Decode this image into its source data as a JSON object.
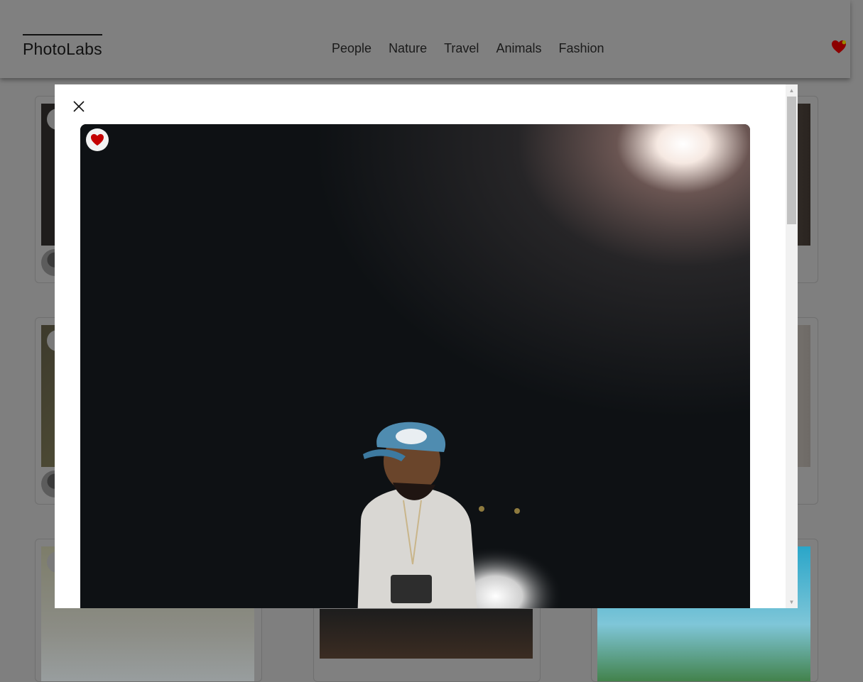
{
  "app": {
    "logo": "PhotoLabs"
  },
  "nav": {
    "topics": [
      "People",
      "Nature",
      "Travel",
      "Animals",
      "Fashion"
    ]
  },
  "favorites": {
    "icon": "heart-icon",
    "has_notification": true
  },
  "modal": {
    "close_icon": "close-icon",
    "photo": {
      "liked": true,
      "like_icon": "heart-icon"
    }
  },
  "colors": {
    "like_red": "#c40000",
    "modal_bg": "#ffffff",
    "overlay": "#7f7f7f"
  }
}
